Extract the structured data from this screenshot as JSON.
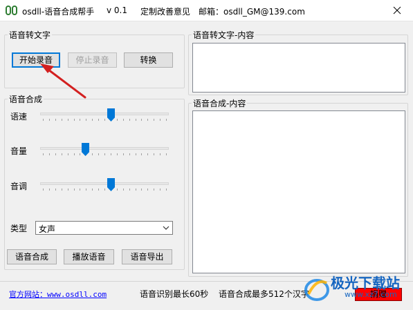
{
  "window": {
    "title": "osdll-语音合成帮手",
    "version": "v 0.1",
    "feedback": "定制改善意见",
    "email": "邮箱：osdll_GM@139.com"
  },
  "stt": {
    "group_label": "语音转文字",
    "start_label": "开始录音",
    "stop_label": "停止录音",
    "convert_label": "转换",
    "content_label": "语音转文字-内容"
  },
  "tts": {
    "group_label": "语音合成",
    "speed_label": "语速",
    "volume_label": "音量",
    "pitch_label": "音调",
    "type_label": "类型",
    "type_value": "女声",
    "synth_label": "语音合成",
    "play_label": "播放语音",
    "export_label": "语音导出",
    "content_label": "语音合成-内容",
    "speed_level": 0.55,
    "volume_level": 0.34,
    "pitch_level": 0.55
  },
  "footer": {
    "site_link": "官方网站：www.osdll.com",
    "stt_limit": "语音识别最长60秒",
    "tts_limit": "语音合成最多512个汉字",
    "donate_label": "捐赠"
  },
  "watermark": {
    "text": "极光下载站",
    "sub": "www.xz7.com"
  },
  "colors": {
    "accent": "#0078d7",
    "donate": "#ff0000",
    "link": "#0000ff",
    "annotation_arrow": "#d32020",
    "watermark": "#1565c0"
  },
  "icons": {
    "app": "app-logo-icon",
    "close": "close-icon",
    "dropdown": "chevron-down-icon",
    "annotation": "red-arrow-annotation"
  }
}
